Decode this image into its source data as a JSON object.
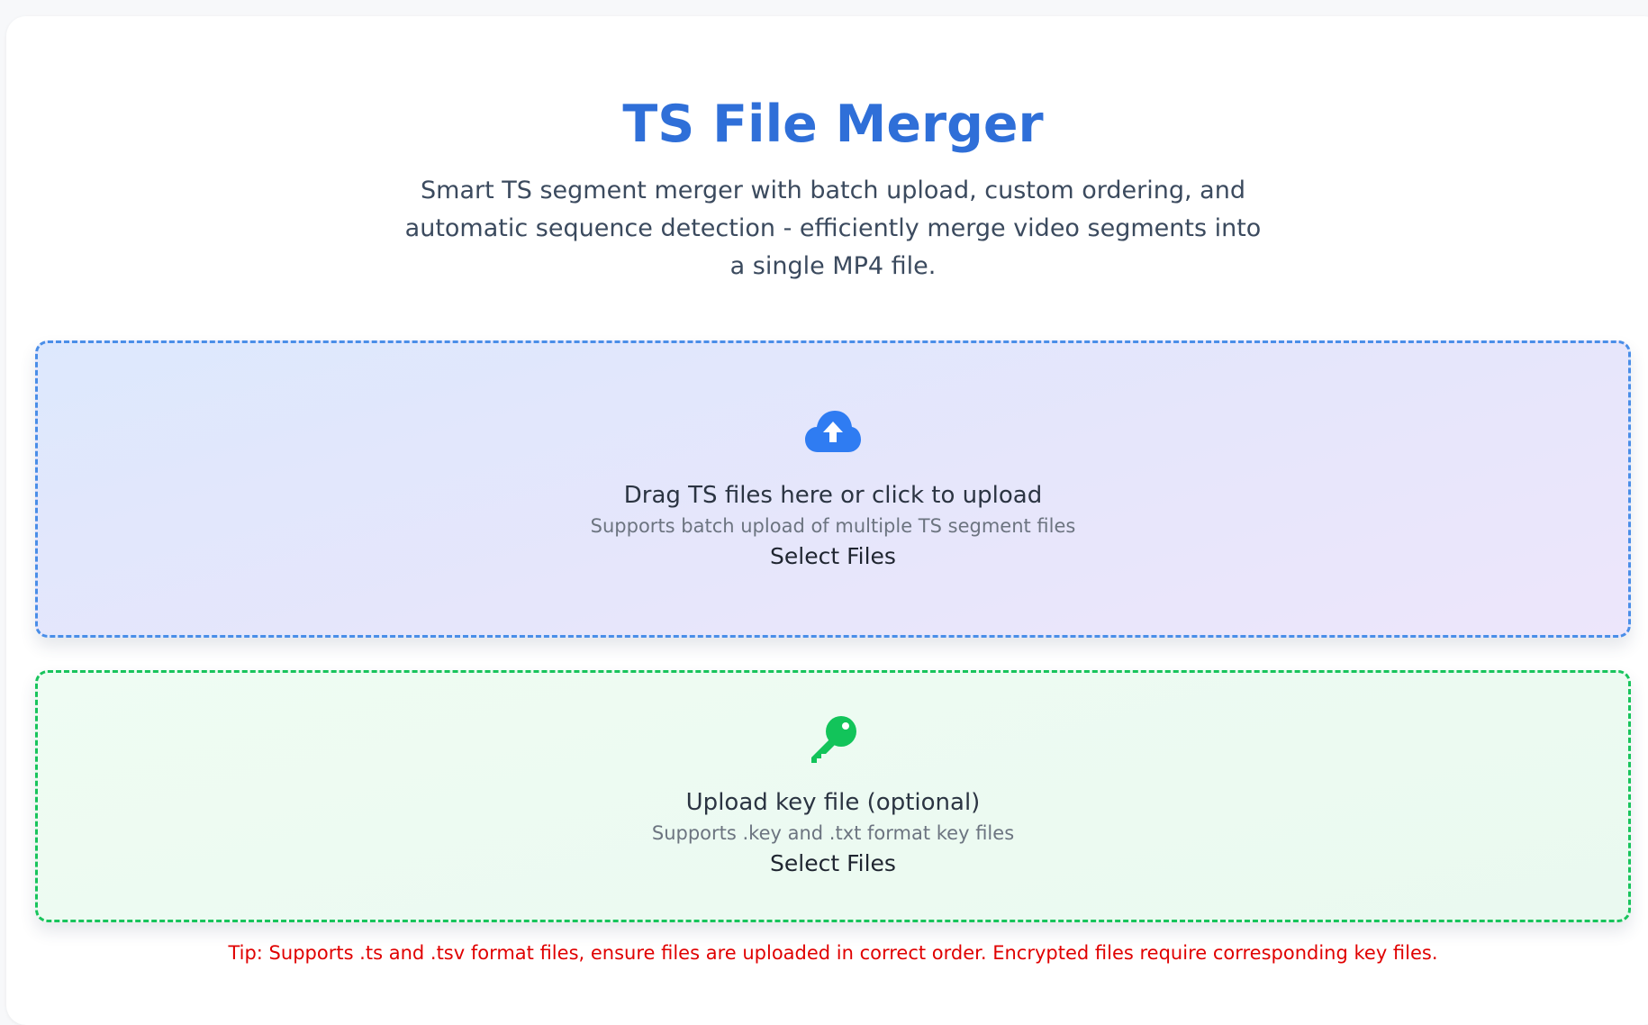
{
  "header": {
    "title": "TS File Merger",
    "subtitle": "Smart TS segment merger with batch upload, custom ordering, and automatic sequence detection - efficiently merge video segments into a single MP4 file."
  },
  "ts_upload": {
    "icon": "cloud-upload-icon",
    "title": "Drag TS files here or click to upload",
    "hint": "Supports batch upload of multiple TS segment files",
    "button_label": "Select Files",
    "accent_color": "#4a8ee8"
  },
  "key_upload": {
    "icon": "key-icon",
    "title": "Upload key file (optional)",
    "hint": "Supports .key and .txt format key files",
    "button_label": "Select Files",
    "accent_color": "#18c45c"
  },
  "tip": {
    "text": "Tip: Supports .ts and .tsv format files, ensure files are uploaded in correct order. Encrypted files require corresponding key files.",
    "color": "#e00000"
  },
  "colors": {
    "title": "#2f6fd8",
    "upload_icon": "#2f7cf2",
    "key_icon": "#12c45a"
  }
}
